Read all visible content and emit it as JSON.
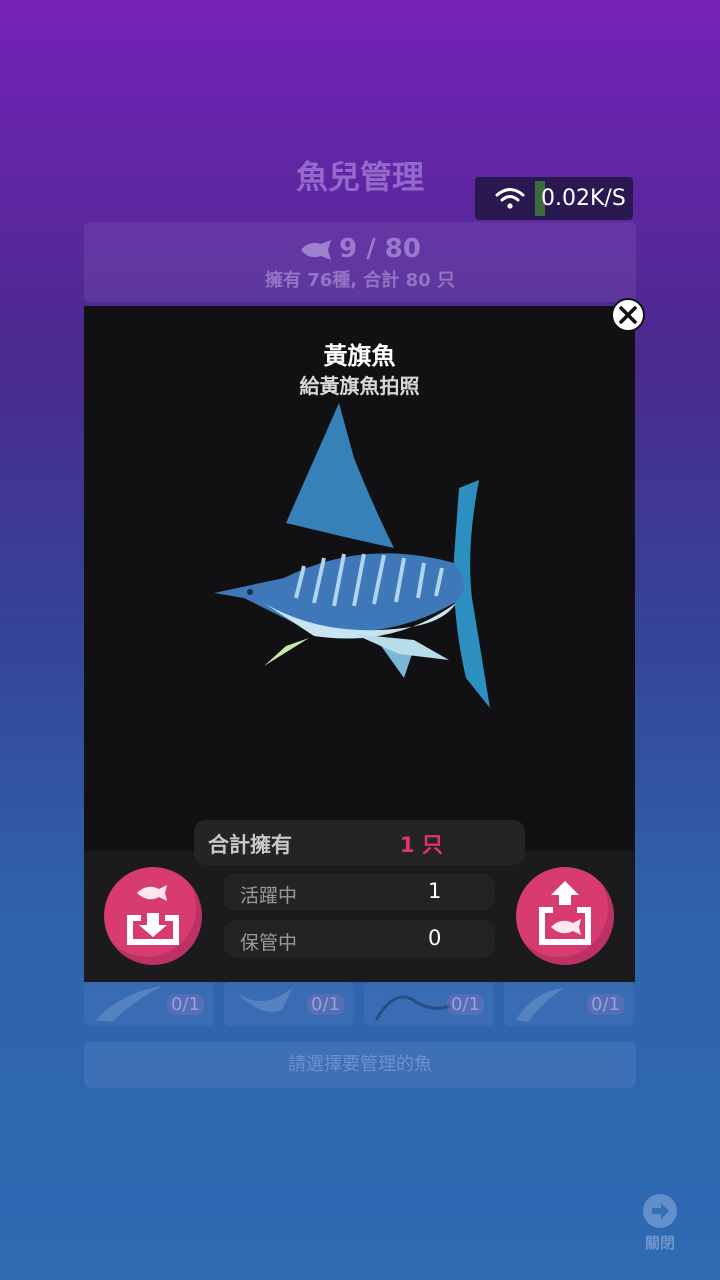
{
  "background": {
    "title": "魚兒管理",
    "fish_count": "9 / 80",
    "fish_summary": "擁有 76種, 合計 80 只",
    "cards": [
      {
        "count": "0/1"
      },
      {
        "count": "0/1"
      },
      {
        "count": "0/1"
      },
      {
        "count": "0/1"
      }
    ],
    "select_hint": "請選擇要管理的魚",
    "close_label": "關閉"
  },
  "status": {
    "network_speed": "0.02K/S"
  },
  "modal": {
    "title": "黃旗魚",
    "subtitle": "給黃旗魚拍照",
    "total_label": "合計擁有",
    "total_value": "1 只",
    "active_label": "活躍中",
    "active_value": "1",
    "stored_label": "保管中",
    "stored_value": "0",
    "left_button_icon": "fish-store-icon",
    "right_button_icon": "fish-release-icon",
    "close_icon": "close-icon"
  },
  "colors": {
    "accent": "#d83a72",
    "total_value": "#e0356e",
    "modal_bg": "#111113"
  }
}
